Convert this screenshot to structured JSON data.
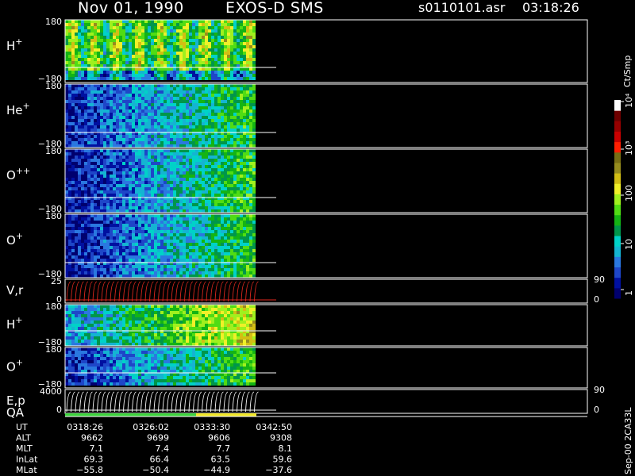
{
  "header": {
    "date": "Nov 01, 1990",
    "mission": "EXOS-D SMS",
    "file": "s0110101.asr",
    "time": "03:18:26"
  },
  "colorbar": {
    "unit": "Ct/Smp",
    "ticks": [
      "1",
      "10",
      "100",
      "10³",
      "10⁴"
    ],
    "colors": [
      "#00006e",
      "#0010a0",
      "#1e46c8",
      "#2a78e0",
      "#14b4d2",
      "#00d2c8",
      "#00964b",
      "#14b414",
      "#50dc14",
      "#a0f01e",
      "#f0f028",
      "#d2be14",
      "#968c1e",
      "#786e14",
      "#ff1e00",
      "#c80000",
      "#960000",
      "#6e0000",
      "#ffffff"
    ]
  },
  "panels": [
    {
      "label_base": "H",
      "label_sup": "+",
      "y_top": "180",
      "y_bottom": "−180"
    },
    {
      "label_base": "He",
      "label_sup": "+",
      "y_top": "180",
      "y_bottom": "−180"
    },
    {
      "label_base": "O",
      "label_sup": "++",
      "y_top": "180",
      "y_bottom": "−180"
    },
    {
      "label_base": "O",
      "label_sup": "+",
      "y_top": "180",
      "y_bottom": "−180"
    },
    {
      "label_base": "V,r",
      "label_sup": "",
      "y_top": "25",
      "y_bottom": "0",
      "right_top": "90",
      "right_bottom": "0"
    },
    {
      "label_base": "H",
      "label_sup": "+",
      "y_top": "180",
      "y_bottom": "−180"
    },
    {
      "label_base": "O",
      "label_sup": "+",
      "y_top": "180",
      "y_bottom": "−180"
    },
    {
      "label_base": "E,p",
      "label_sup": "",
      "y_top": "4000",
      "y_bottom": "0",
      "right_top": "90",
      "right_bottom": "0"
    }
  ],
  "qa": {
    "label": "QA"
  },
  "footer_side": "Sep-00 2CA33L",
  "ephemeris": {
    "rows": [
      {
        "name": "UT",
        "values": [
          "0318:26",
          "0326:02",
          "0333:30",
          "0342:50"
        ]
      },
      {
        "name": "ALT",
        "values": [
          "9662",
          "9699",
          "9606",
          "9308"
        ]
      },
      {
        "name": "MLT",
        "values": [
          "7.1",
          "7.4",
          "7.7",
          "8.1"
        ]
      },
      {
        "name": "InLat",
        "values": [
          "69.3",
          "66.4",
          "63.5",
          "59.6"
        ]
      },
      {
        "name": "MLat",
        "values": [
          "−55.8",
          "−50.4",
          "−44.9",
          "−37.6"
        ]
      }
    ]
  },
  "chart_data": {
    "type": "heatmap",
    "title": "Nov 01, 1990   EXOS-D SMS",
    "colorbar_label": "Ct/Smp",
    "colorbar_scale": "log",
    "colorbar_range": [
      1,
      10000
    ],
    "x_ticks": [
      "0318:26",
      "0326:02",
      "0333:30",
      "0342:50"
    ],
    "panels": [
      {
        "label": "H+",
        "ylim": [
          -180,
          180
        ]
      },
      {
        "label": "He+",
        "ylim": [
          -180,
          180
        ]
      },
      {
        "label": "O++",
        "ylim": [
          -180,
          180
        ]
      },
      {
        "label": "O+",
        "ylim": [
          -180,
          180
        ]
      },
      {
        "label": "V,r",
        "ylim": [
          0,
          25
        ],
        "right_ylim": [
          0,
          90
        ]
      },
      {
        "label": "H+",
        "ylim": [
          -180,
          180
        ]
      },
      {
        "label": "O+",
        "ylim": [
          -180,
          180
        ]
      },
      {
        "label": "E,p",
        "ylim": [
          0,
          4000
        ],
        "right_ylim": [
          0,
          90
        ]
      }
    ]
  }
}
